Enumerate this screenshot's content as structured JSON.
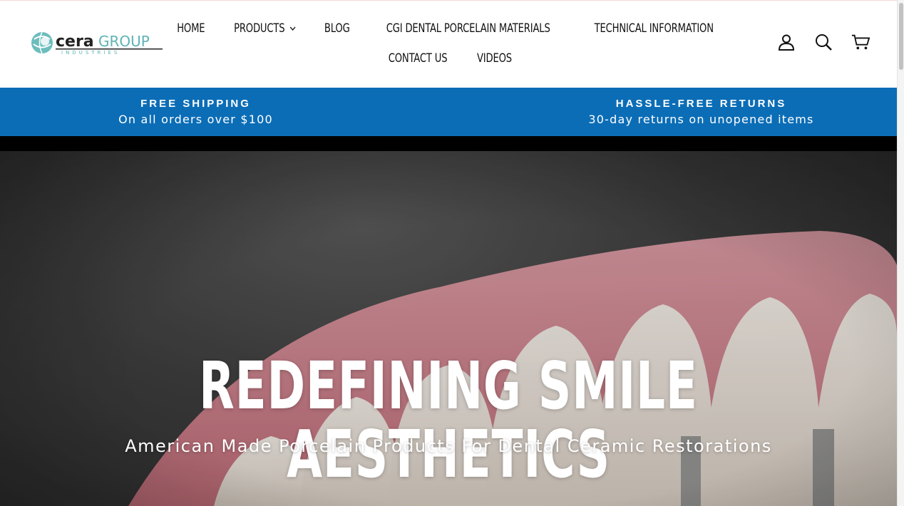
{
  "brand": {
    "logo_text_main": "ceraGroup",
    "logo_text_sub": "INDUSTRIES",
    "accent_color": "#5fb3b3"
  },
  "nav": {
    "row1": [
      {
        "label": "HOME",
        "dropdown": false
      },
      {
        "label": "PRODUCTS",
        "dropdown": true
      },
      {
        "label": "BLOG",
        "dropdown": false
      },
      {
        "label": "CGI DENTAL PORCELAIN MATERIALS",
        "dropdown": false
      },
      {
        "label": "TECHNICAL INFORMATION",
        "dropdown": false
      }
    ],
    "row2": [
      {
        "label": "CONTACT US",
        "dropdown": false
      },
      {
        "label": "VIDEOS",
        "dropdown": false
      }
    ]
  },
  "header_icons": [
    "account-icon",
    "search-icon",
    "cart-icon"
  ],
  "announcement": {
    "background": "#0b6db6",
    "items": [
      {
        "title": "FREE SHIPPING",
        "subtitle": "On all orders over $100"
      },
      {
        "title": "HASSLE-FREE RETURNS",
        "subtitle": "30-day returns on unopened items"
      }
    ]
  },
  "hero": {
    "title": "REDEFINING SMILE AESTHETICS",
    "subtitle": "American Made Porcelain Products For Dental Ceramic Restorations"
  }
}
